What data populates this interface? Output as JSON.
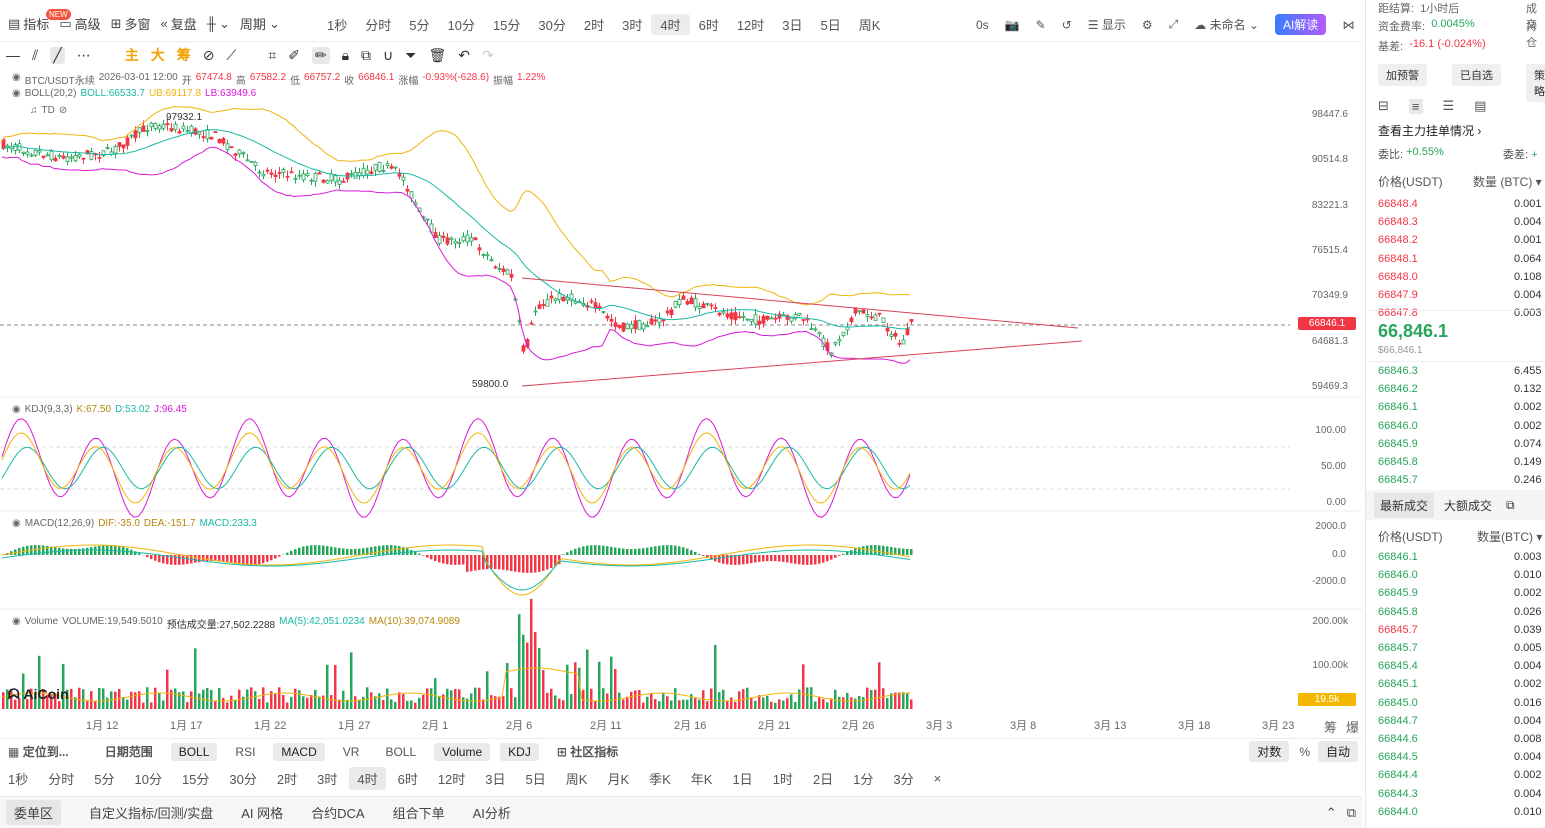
{
  "toolbar": {
    "new_badge": "NEW",
    "indicators": "指标",
    "advanced": "高级",
    "multi_window": "多窗",
    "replay": "复盘",
    "period_label": "周期",
    "periods": [
      "1秒",
      "分时",
      "5分",
      "10分",
      "15分",
      "30分",
      "2时",
      "3时",
      "4时",
      "6时",
      "12时",
      "3日",
      "5日",
      "周K"
    ],
    "active_period": "4时",
    "countdown": "0s",
    "display": "显示",
    "layout_name": "未命名",
    "ai_button": "AI解读"
  },
  "drawing_tools": {
    "main": "主",
    "large": "大",
    "chips": "筹"
  },
  "legend": {
    "symbol": "BTC/USDT永续",
    "datetime": "2026-03-01 12:00",
    "open_label": "开",
    "open": "67474.8",
    "high_label": "高",
    "high": "67582.2",
    "low_label": "低",
    "low": "66757.2",
    "close_label": "收",
    "close": "66846.1",
    "change_label": "涨幅",
    "change": "-0.93%(-628.6)",
    "amplitude_label": "振幅",
    "amplitude": "1.22%",
    "boll_name": "BOLL(20,2)",
    "boll_mid": "BOLL:66533.7",
    "boll_ub": "UB:69117.8",
    "boll_lb": "LB:63949.6",
    "td": "TD"
  },
  "price_axis": [
    "98447.6",
    "90514.8",
    "83221.3",
    "76515.4",
    "70349.9",
    "64681.3",
    "59469.3"
  ],
  "last_price_tag": "66846.1",
  "annotations": {
    "high": "97932.1",
    "low": "59800.0"
  },
  "kdj": {
    "name": "KDJ(9,3,3)",
    "k": "K:67.50",
    "d": "D:53.02",
    "j": "J:96.45",
    "axis": [
      "100.00",
      "50.00",
      "0.00"
    ]
  },
  "macd": {
    "name": "MACD(12,26,9)",
    "dif": "DIF:-35.0",
    "dea": "DEA:-151.7",
    "macd": "MACD:233.3",
    "axis": [
      "2000.0",
      "0.0",
      "-2000.0"
    ]
  },
  "volume": {
    "name": "Volume",
    "value": "VOLUME:19,549.5010",
    "estimate": "预估成交量:27,502.2288",
    "ma5": "MA(5):42,051.0234",
    "ma10": "MA(10):39,074.9089",
    "axis": [
      "200.00k",
      "100.00k"
    ],
    "tag": "19.5k"
  },
  "watermark": "AiCoin",
  "dates": [
    "1月 12",
    "1月 17",
    "1月 22",
    "1月 27",
    "2月 1",
    "2月 6",
    "2月 11",
    "2月 16",
    "2月 21",
    "2月 26",
    "3月 3",
    "3月 8",
    "3月 13",
    "3月 18",
    "3月 23"
  ],
  "date_corner": [
    "筹",
    "爆"
  ],
  "indicator_bar": {
    "locate": "定位到...",
    "date_range": "日期范围",
    "items": [
      "BOLL",
      "RSI",
      "MACD",
      "VR",
      "BOLL",
      "Volume",
      "KDJ"
    ],
    "active": [
      "BOLL",
      "MACD",
      "Volume",
      "KDJ"
    ],
    "community": "社区指标",
    "log": "对数",
    "percent": "%",
    "auto": "自动"
  },
  "period_bar": [
    "1秒",
    "分时",
    "5分",
    "10分",
    "15分",
    "30分",
    "2时",
    "3时",
    "4时",
    "6时",
    "12时",
    "3日",
    "5日",
    "周K",
    "月K",
    "季K",
    "年K",
    "1日",
    "1时",
    "2日",
    "1分",
    "3分"
  ],
  "footer": [
    "委单区",
    "自定义指标/回测/实盘",
    "AI 网格",
    "合约DCA",
    "组合下单",
    "AI分析"
  ],
  "right_panel": {
    "settle_label": "距结算:",
    "settle_value": "1小时后",
    "funding_label": "资金费率:",
    "funding_value": "0.0045%",
    "basis_label": "基差:",
    "basis_value": "-16.1 (-0.024%)",
    "col_deal": "成交",
    "col_hold": "持仓",
    "buttons": [
      "加预警",
      "已自选",
      "策略"
    ],
    "orderbook_title": "查看主力挂单情况",
    "ratio_label": "委比:",
    "ratio_value": "+0.55%",
    "diff_label": "委差:",
    "diff_value": "+",
    "price_header": "价格(USDT)",
    "qty_header": "数量 (BTC)",
    "asks": [
      [
        "66848.4",
        "0.001"
      ],
      [
        "66848.3",
        "0.004"
      ],
      [
        "66848.2",
        "0.001"
      ],
      [
        "66848.1",
        "0.064"
      ],
      [
        "66848.0",
        "0.108"
      ],
      [
        "66847.9",
        "0.004"
      ],
      [
        "66847.8",
        "0.003"
      ]
    ],
    "last_price": "66,846.1",
    "last_price_sub": "$66,846.1",
    "bids": [
      [
        "66846.3",
        "6.455"
      ],
      [
        "66846.2",
        "0.132"
      ],
      [
        "66846.1",
        "0.002"
      ],
      [
        "66846.0",
        "0.002"
      ],
      [
        "66845.9",
        "0.074"
      ],
      [
        "66845.8",
        "0.149"
      ],
      [
        "66845.7",
        "0.246"
      ]
    ],
    "trade_tabs": [
      "最新成交",
      "大额成交"
    ],
    "trades_price_header": "价格(USDT)",
    "trades_qty_header": "数量(BTC)",
    "trades": [
      [
        "66846.1",
        "0.003",
        "bid"
      ],
      [
        "66846.0",
        "0.010",
        "bid"
      ],
      [
        "66845.9",
        "0.002",
        "bid"
      ],
      [
        "66845.8",
        "0.026",
        "bid"
      ],
      [
        "66845.7",
        "0.039",
        "ask"
      ],
      [
        "66845.7",
        "0.005",
        "bid"
      ],
      [
        "66845.4",
        "0.004",
        "bid"
      ],
      [
        "66845.1",
        "0.002",
        "bid"
      ],
      [
        "66845.0",
        "0.016",
        "bid"
      ],
      [
        "66844.7",
        "0.004",
        "bid"
      ],
      [
        "66844.6",
        "0.008",
        "bid"
      ],
      [
        "66844.5",
        "0.004",
        "bid"
      ],
      [
        "66844.4",
        "0.002",
        "bid"
      ],
      [
        "66844.3",
        "0.004",
        "bid"
      ],
      [
        "66844.0",
        "0.010",
        "bid"
      ]
    ]
  },
  "colors": {
    "up": "#26a65b",
    "down": "#f23645",
    "boll_mid": "#18b9a6",
    "boll_ub": "#f0b40c",
    "boll_lb": "#d81ad8",
    "triangle": "#d9415a",
    "k": "#f0b40c",
    "d": "#18b9a6",
    "j": "#d81ad8"
  }
}
